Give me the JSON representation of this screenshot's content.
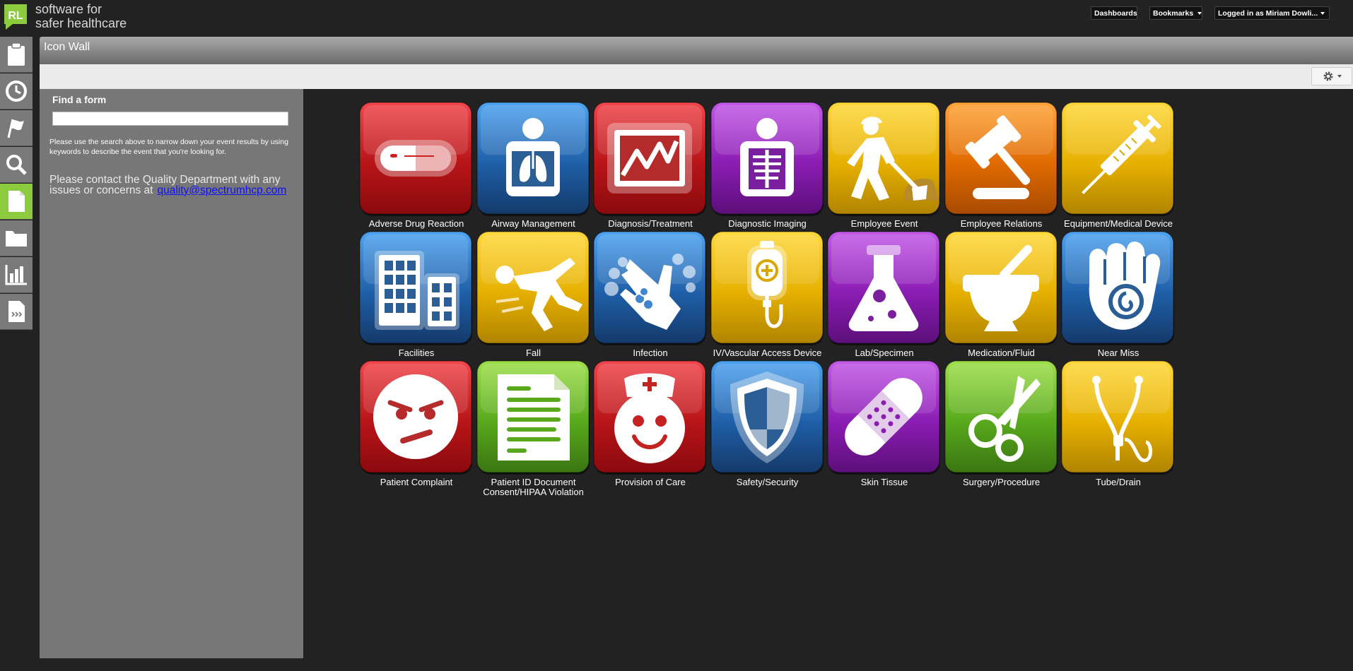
{
  "brand": {
    "logo_text": "RL",
    "line1": "software for",
    "line2": "safer healthcare"
  },
  "topnav": {
    "dashboards": "Dashboards",
    "bookmarks": "Bookmarks",
    "user": "Logged in as Miriam Dowli..."
  },
  "page": {
    "title": "Icon Wall"
  },
  "sidebar": {
    "find_label": "Find a form",
    "search_value": "",
    "help_text": "Please use the search above to narrow down your event results by using keywords to describe the event that you're looking for.",
    "contact_text": "Please contact the Quality Department with any issues or concerns at",
    "contact_email": "quality@spectrumhcp.com"
  },
  "tiles": [
    {
      "label": "Adverse Drug Reaction",
      "color": "red",
      "icon": "pill-icon"
    },
    {
      "label": "Airway Management",
      "color": "blue",
      "icon": "lungs-xray-icon"
    },
    {
      "label": "Diagnosis/Treatment",
      "color": "red",
      "icon": "monitor-chart-icon"
    },
    {
      "label": "Diagnostic Imaging",
      "color": "purple",
      "icon": "skeleton-xray-icon"
    },
    {
      "label": "Employee Event",
      "color": "yellow",
      "icon": "worker-shovel-icon"
    },
    {
      "label": "Employee Relations",
      "color": "orange",
      "icon": "gavel-icon"
    },
    {
      "label": "Equipment/Medical Device",
      "color": "yellow",
      "icon": "syringe-icon"
    },
    {
      "label": "Facilities",
      "color": "blue",
      "icon": "buildings-icon"
    },
    {
      "label": "Fall",
      "color": "yellow",
      "icon": "falling-person-icon"
    },
    {
      "label": "Infection",
      "color": "blue",
      "icon": "washing-hands-icon"
    },
    {
      "label": "IV/Vascular Access Device",
      "color": "yellow",
      "icon": "iv-bag-icon"
    },
    {
      "label": "Lab/Specimen",
      "color": "purple",
      "icon": "flask-icon"
    },
    {
      "label": "Medication/Fluid",
      "color": "yellow",
      "icon": "mortar-pestle-icon"
    },
    {
      "label": "Near Miss",
      "color": "blue",
      "icon": "baseball-glove-icon"
    },
    {
      "label": "Patient Complaint",
      "color": "red",
      "icon": "angry-face-icon"
    },
    {
      "label": "Patient ID Document Consent/HIPAA Violation",
      "color": "green",
      "icon": "document-icon"
    },
    {
      "label": "Provision of Care",
      "color": "red",
      "icon": "nurse-face-icon"
    },
    {
      "label": "Safety/Security",
      "color": "blue",
      "icon": "shield-icon"
    },
    {
      "label": "Skin Tissue",
      "color": "purple",
      "icon": "bandage-icon"
    },
    {
      "label": "Surgery/Procedure",
      "color": "green",
      "icon": "scissors-icon"
    },
    {
      "label": "Tube/Drain",
      "color": "yellow",
      "icon": "tube-icon"
    }
  ],
  "colors": {
    "red": [
      "#f0464c",
      "#b81418",
      "#8a0a0e"
    ],
    "blue": [
      "#4ea3f0",
      "#1f5fa8",
      "#143a6a"
    ],
    "purple": [
      "#c35ae8",
      "#8b1cb3",
      "#5c0f7a"
    ],
    "yellow": [
      "#ffd83a",
      "#e6b000",
      "#b08400"
    ],
    "orange": [
      "#ffa43a",
      "#e06a00",
      "#a84a00"
    ],
    "green": [
      "#9ee04a",
      "#58a81c",
      "#3a7512"
    ],
    "accent_green": "#8ccb3e",
    "link": "#1010ff"
  }
}
